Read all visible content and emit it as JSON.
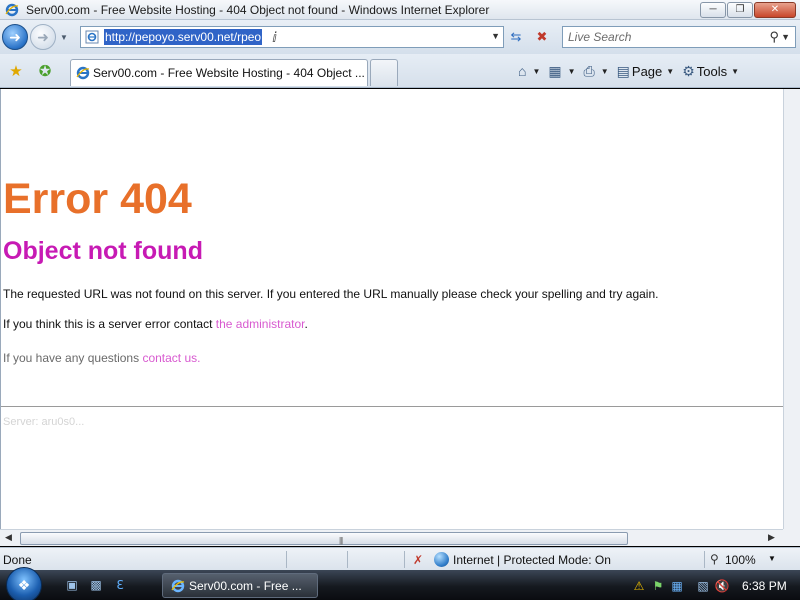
{
  "window": {
    "title": "Serv00.com - Free Website Hosting - 404 Object not found - Windows Internet Explorer",
    "minimize_icon": "minimize-icon",
    "maximize_icon": "maximize-icon",
    "close_icon": "close-icon"
  },
  "address_bar": {
    "url": "http://pepoyo.serv00.net/rpeo",
    "refresh_icon": "refresh-icon",
    "stop_icon": "stop-icon"
  },
  "search": {
    "placeholder": "Live Search"
  },
  "tab": {
    "label": "Serv00.com - Free Website Hosting - 404 Object ..."
  },
  "commands": {
    "home_icon": "home-icon",
    "feeds_icon": "feeds-icon",
    "print_icon": "print-icon",
    "page_label": "Page",
    "tools_label": "Tools"
  },
  "page": {
    "error_title": "Error 404",
    "error_subtitle": "Object not found",
    "message": "The requested URL was not found on this server. If you entered the URL manually please check your spelling and try again.",
    "contact_prefix": "If you think this is a server error contact ",
    "contact_link": "the administrator",
    "contact_suffix": ".",
    "questions_prefix": "If you have any questions ",
    "questions_link": "contact us.",
    "server_line": "Server: aru0s0..."
  },
  "status_bar": {
    "status": "Done",
    "zone": "Internet | Protected Mode: On",
    "zoom": "100%"
  },
  "taskbar": {
    "task_label": "Serv00.com - Free ...",
    "clock": "6:38 PM"
  },
  "colors": {
    "error_title": "#e8702a",
    "error_subtitle": "#c71ab4",
    "link": "#d85ad0"
  }
}
